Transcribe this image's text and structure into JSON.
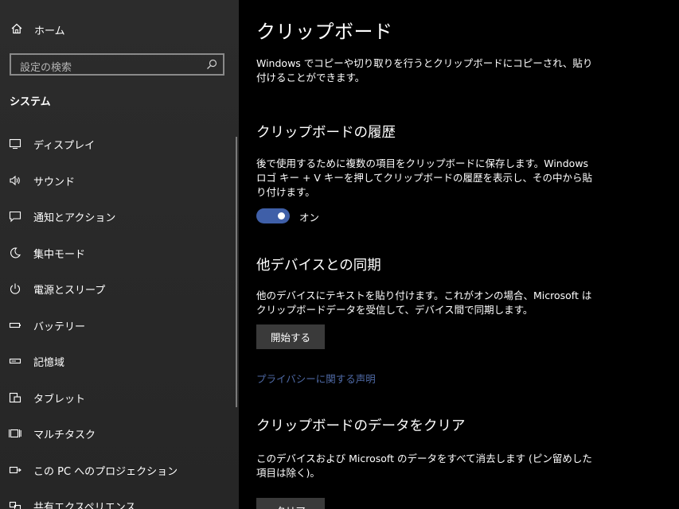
{
  "sidebar": {
    "home_label": "ホーム",
    "search_placeholder": "設定の検索",
    "section_title": "システム",
    "items": [
      {
        "label": "ディスプレイ",
        "icon": "monitor-icon"
      },
      {
        "label": "サウンド",
        "icon": "speaker-icon"
      },
      {
        "label": "通知とアクション",
        "icon": "notification-icon"
      },
      {
        "label": "集中モード",
        "icon": "moon-icon"
      },
      {
        "label": "電源とスリープ",
        "icon": "power-icon"
      },
      {
        "label": "バッテリー",
        "icon": "battery-icon"
      },
      {
        "label": "記憶域",
        "icon": "storage-icon"
      },
      {
        "label": "タブレット",
        "icon": "tablet-icon"
      },
      {
        "label": "マルチタスク",
        "icon": "multitask-icon"
      },
      {
        "label": "この PC へのプロジェクション",
        "icon": "projection-icon"
      },
      {
        "label": "共有エクスペリエンス",
        "icon": "shared-icon"
      }
    ]
  },
  "main": {
    "title": "クリップボード",
    "intro": "Windows でコピーや切り取りを行うとクリップボードにコピーされ、貼り付けることができます。",
    "history": {
      "heading": "クリップボードの履歴",
      "description": "後で使用するために複数の項目をクリップボードに保存します。Windows ロゴ キー + V キーを押してクリップボードの履歴を表示し、その中から貼り付けます。",
      "toggle_label": "オン",
      "toggle_state": "on"
    },
    "sync": {
      "heading": "他デバイスとの同期",
      "description": "他のデバイスにテキストを貼り付けます。これがオンの場合、Microsoft はクリップボードデータを受信して、デバイス間で同期します。",
      "button_label": "開始する",
      "privacy_link": "プライバシーに関する声明"
    },
    "clear": {
      "heading": "クリップボードのデータをクリア",
      "description": "このデバイスおよび Microsoft のデータをすべて消去します (ピン留めした項目は除く)。",
      "button_label": "クリア"
    }
  },
  "colors": {
    "sidebar_bg": "#2b2b2b",
    "content_bg": "#000000",
    "accent": "#3f5fa8",
    "link": "#4f6aa6",
    "button_bg": "#3a3a3a"
  }
}
